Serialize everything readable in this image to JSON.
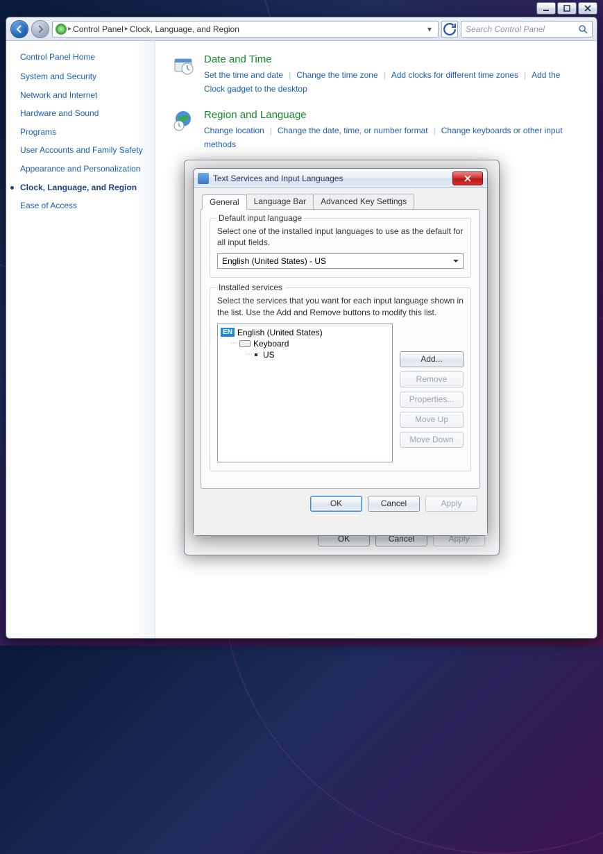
{
  "window_controls": {
    "min": "minimize",
    "max": "maximize",
    "close": "close"
  },
  "nav": {
    "breadcrumb_root": "Control Panel",
    "breadcrumb_current": "Clock, Language, and Region",
    "search_placeholder": "Search Control Panel"
  },
  "sidebar": {
    "home": "Control Panel Home",
    "items": [
      "System and Security",
      "Network and Internet",
      "Hardware and Sound",
      "Programs",
      "User Accounts and Family Safety",
      "Appearance and Personalization",
      "Clock, Language, and Region",
      "Ease of Access"
    ],
    "current_index": 6
  },
  "categories": [
    {
      "title": "Date and Time",
      "links": [
        "Set the time and date",
        "Change the time zone",
        "Add clocks for different time zones",
        "Add the Clock gadget to the desktop"
      ]
    },
    {
      "title": "Region and Language",
      "links": [
        "Change location",
        "Change the date, time, or number format",
        "Change keyboards or other input methods"
      ]
    }
  ],
  "under_dialog": {
    "buttons": {
      "ok": "OK",
      "cancel": "Cancel",
      "apply": "Apply"
    }
  },
  "dialog": {
    "title": "Text Services and Input Languages",
    "tabs": [
      "General",
      "Language Bar",
      "Advanced Key Settings"
    ],
    "active_tab": 0,
    "group_default": {
      "label": "Default input language",
      "desc": "Select one of the installed input languages to use as the default for all input fields.",
      "value": "English (United States) - US"
    },
    "group_services": {
      "label": "Installed services",
      "desc": "Select the services that you want for each input language shown in the list. Use the Add and Remove buttons to modify this list.",
      "tree": {
        "lang_badge": "EN",
        "lang_name": "English (United States)",
        "keyboard_label": "Keyboard",
        "layout": "US"
      },
      "buttons": {
        "add": "Add...",
        "remove": "Remove",
        "properties": "Properties...",
        "moveup": "Move Up",
        "movedown": "Move Down"
      }
    },
    "bottom": {
      "ok": "OK",
      "cancel": "Cancel",
      "apply": "Apply"
    }
  }
}
